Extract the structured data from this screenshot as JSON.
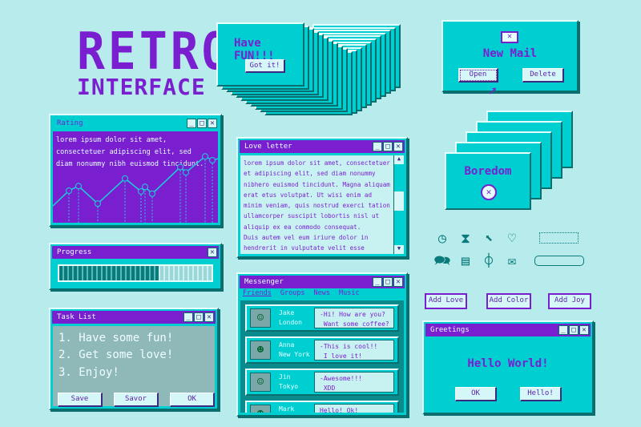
{
  "title": {
    "line1": "RETRO",
    "line2": "INTERFACE"
  },
  "colors": {
    "background": "#b8ecec",
    "window": "#00cfd2",
    "titlebar": "#7a1fd0",
    "shadow": "#0a6e6e",
    "text": "#7a1fd0"
  },
  "fun": {
    "text": "Have FUN!!!",
    "button": "Got it!"
  },
  "mail": {
    "icon": "envelope-icon",
    "title": "New Mail",
    "open": "Open",
    "delete": "Delete"
  },
  "rating": {
    "title": "Rating",
    "text": "lorem ipsum dolor sit amet, consectetuer adipiscing elit, sed diam nonummy nibh euismod tincidunt."
  },
  "chart_data": {
    "type": "line",
    "x": [
      0,
      1,
      2,
      3,
      4,
      5,
      6,
      7,
      8,
      9,
      10,
      11,
      12
    ],
    "values": [
      2,
      4,
      4.6,
      2.3,
      5.6,
      3.9,
      4.5,
      3.6,
      7.1,
      6.4,
      8.5,
      8,
      8.2
    ],
    "markers": [
      1,
      2,
      3,
      4,
      5,
      6,
      7,
      8,
      9,
      10,
      11
    ],
    "grid": false
  },
  "love": {
    "title": "Love letter",
    "text": "lorem ipsum dolor sit amet, consectetuer et adipiscing elit, sed diam nonummy nibhero euismod tincidunt. Magna aliquam erat etus volutpat. Ut wisi enim ad minim veniam, quis nostrud exerci tation ullamcorper suscipit lobortis nisl ut aliquip ex ea commodo consequat.\nDuis autem vel eum iriure dolor in hendrerit in vulputate velit esse molestie consequat."
  },
  "boredom": {
    "title": "Boredom",
    "icon": "close-circle-icon"
  },
  "progress": {
    "title": "Progress",
    "value_percent": 65
  },
  "tasks": {
    "title": "Task List",
    "items": [
      "1. Have some fun!",
      "2. Get some love!",
      "3. Enjoy!"
    ],
    "save": "Save",
    "savor": "Savor",
    "ok": "OK"
  },
  "messenger": {
    "title": "Messenger",
    "menu": [
      "Friends",
      "Groups",
      "News",
      "Music"
    ],
    "contacts": [
      {
        "name": "Jake\nLondon",
        "msg": "-Hi! How are you?\n Want some coffee?"
      },
      {
        "name": "Anna\nNew York",
        "msg": "-This is cool!!\n I love it!"
      },
      {
        "name": "Jin\nTokyo",
        "msg": "-Awesome!!!\n XDD"
      },
      {
        "name": "Mark",
        "msg": "Hello! Ok!"
      }
    ]
  },
  "icons": [
    "clock-icon",
    "hourglass-icon",
    "cursor-icon",
    "heart-icon",
    "chat-icon",
    "document-icon",
    "paperclip-icon",
    "envelope-icon"
  ],
  "add_buttons": [
    "Add Love",
    "Add Color",
    "Add Joy"
  ],
  "greetings": {
    "title": "Greetings",
    "text": "Hello World!",
    "ok": "OK",
    "hello": "Hello!"
  }
}
